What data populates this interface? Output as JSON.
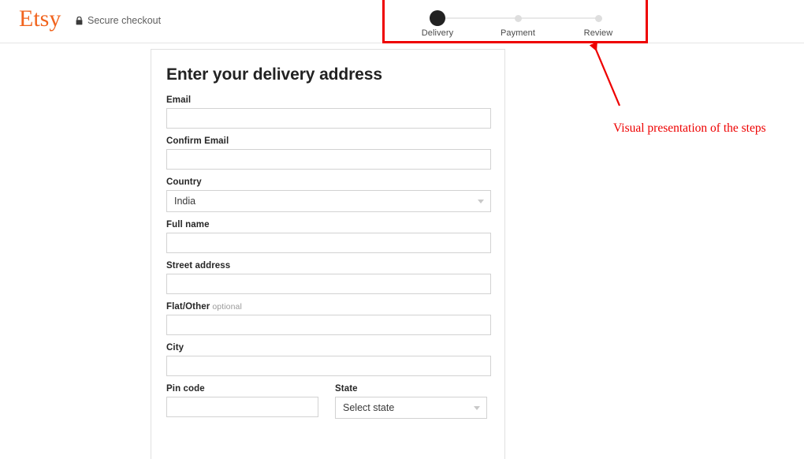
{
  "header": {
    "brand": "Etsy",
    "brand_color": "#F1641E",
    "secure_label": "Secure checkout",
    "lock_icon": "lock-icon"
  },
  "stepper": {
    "steps": [
      {
        "label": "Delivery",
        "state": "active"
      },
      {
        "label": "Payment",
        "state": "inactive"
      },
      {
        "label": "Review",
        "state": "inactive"
      }
    ],
    "active_color": "#222222",
    "inactive_color": "#dedede",
    "track_color": "#e8e8e8"
  },
  "annotation": {
    "text": "Visual presentation of the steps",
    "color": "#ee0000",
    "box_label": "stepper-highlight-box",
    "arrow_label": "callout-arrow"
  },
  "form": {
    "title": "Enter your delivery address",
    "fields": [
      {
        "label": "Email",
        "type": "text",
        "value": "",
        "placeholder": ""
      },
      {
        "label": "Confirm Email",
        "type": "text",
        "value": "",
        "placeholder": ""
      },
      {
        "label": "Country",
        "type": "select",
        "value": "India",
        "options": [
          "India"
        ]
      },
      {
        "label": "Full name",
        "type": "text",
        "value": "",
        "placeholder": ""
      },
      {
        "label": "Street address",
        "type": "text",
        "value": "",
        "placeholder": ""
      },
      {
        "label": "Flat/Other",
        "optional": "optional",
        "type": "text",
        "value": "",
        "placeholder": ""
      },
      {
        "label": "City",
        "type": "text",
        "value": "",
        "placeholder": ""
      },
      {
        "label": "Pin code",
        "type": "text",
        "value": "",
        "placeholder": ""
      },
      {
        "label": "State",
        "type": "select",
        "value": "Select state",
        "options": [
          "Select state"
        ]
      }
    ]
  }
}
